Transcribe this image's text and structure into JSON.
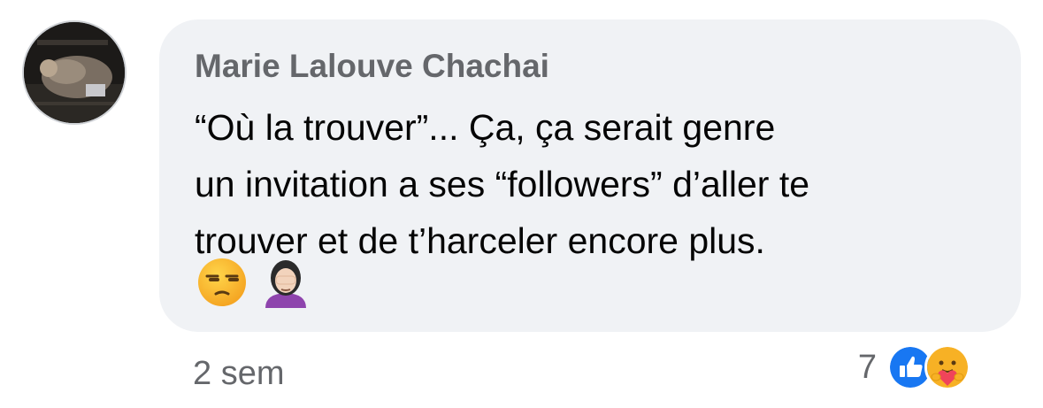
{
  "comment": {
    "author": "Marie Lalouve Chachai",
    "lines": [
      "“Où la trouver”... Ça, ça serait genre",
      "un invitation a ses “followers” d’aller te",
      "trouver et de t’harceler encore plus."
    ],
    "emojis": [
      "unamused-face",
      "woman-facepalming"
    ],
    "timestamp": "2 sem",
    "reaction_count": "7",
    "reactions": [
      "like",
      "care"
    ]
  },
  "colors": {
    "bubble": "#f0f2f5",
    "author": "#65676b",
    "text": "#050505",
    "meta": "#65676b",
    "like_blue": "#1877f2"
  }
}
